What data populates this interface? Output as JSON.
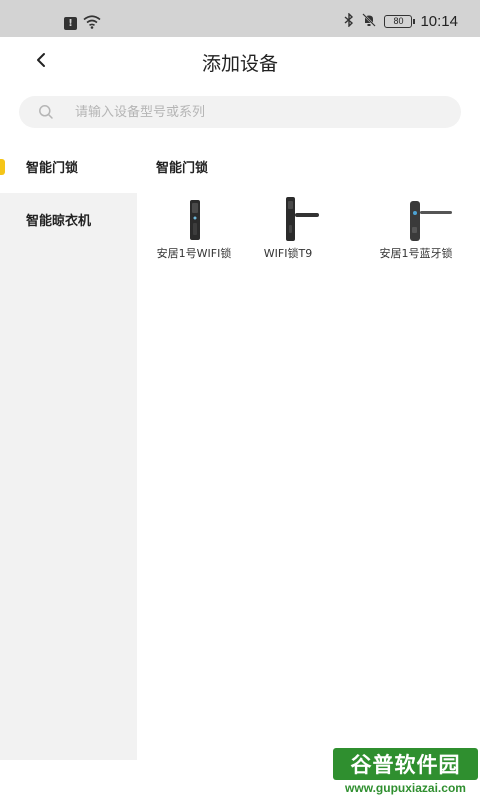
{
  "status_bar": {
    "time": "10:14",
    "battery": "80",
    "icons": [
      "alert-icon",
      "wifi-icon",
      "bluetooth-icon",
      "mute-icon",
      "battery-icon"
    ]
  },
  "nav": {
    "title": "添加设备",
    "back_icon": "chevron-left-icon"
  },
  "search": {
    "placeholder": "请输入设备型号或系列",
    "icon": "search-icon"
  },
  "sidebar": {
    "items": [
      {
        "label": "智能门锁",
        "active": true
      },
      {
        "label": "智能晾衣机",
        "active": false
      }
    ],
    "accent_color": "#f5c518"
  },
  "main": {
    "section_title": "智能门锁",
    "products": [
      {
        "label": "安居1号WIFI锁"
      },
      {
        "label": "WIFI锁T9"
      },
      {
        "label": "安居1号蓝牙锁"
      }
    ]
  },
  "watermark": {
    "title": "谷普软件园",
    "url": "www.gupuxiazai.com"
  }
}
